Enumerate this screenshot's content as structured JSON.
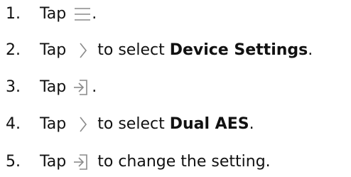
{
  "steps": [
    {
      "number": "1.",
      "verb": "Tap",
      "icon": "menu-icon",
      "after": "."
    },
    {
      "number": "2.",
      "verb": "Tap",
      "icon": "chevron-right-icon",
      "text": "to select",
      "bold": "Device Settings",
      "after": "."
    },
    {
      "number": "3.",
      "verb": "Tap",
      "icon": "enter-icon",
      "after": "."
    },
    {
      "number": "4.",
      "verb": "Tap",
      "icon": "chevron-right-icon",
      "text": "to select",
      "bold": "Dual AES",
      "after": "."
    },
    {
      "number": "5.",
      "verb": "Tap",
      "icon": "enter-icon",
      "text": "to change the setting."
    }
  ]
}
